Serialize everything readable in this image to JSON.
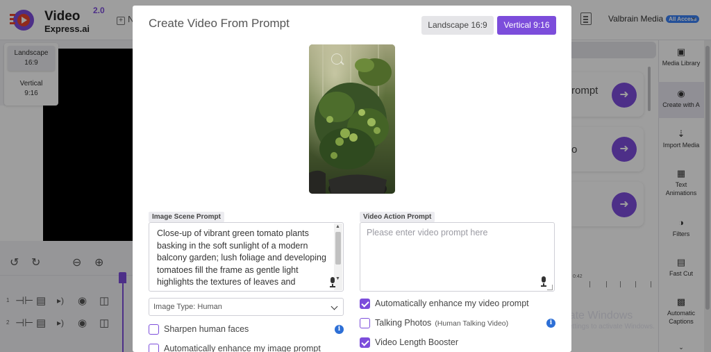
{
  "app": {
    "logo_name": "Video",
    "logo_sub": "Express.ai",
    "logo_version": "2.0",
    "top_new": "N",
    "user_name": "Valbrain Media",
    "access_badge": "All Access"
  },
  "ratio_panel": {
    "landscape": "Landscape\n16:9",
    "vertical": "Vertical\n9:16"
  },
  "right_panel": {
    "cards": [
      {
        "text": "rompt"
      },
      {
        "text": "o"
      },
      {
        "text": ""
      }
    ],
    "ruler_label": "0:42"
  },
  "sidebar": {
    "items": [
      {
        "label": "Media Library",
        "icon": "media-library-icon"
      },
      {
        "label": "Create with A",
        "icon": "robot-icon"
      },
      {
        "label": "Import Media",
        "icon": "import-icon"
      },
      {
        "label": "Text Animations",
        "icon": "film-icon"
      },
      {
        "label": "Filters",
        "icon": "filter-icon"
      },
      {
        "label": "Fast Cut",
        "icon": "fast-cut-icon"
      },
      {
        "label": "Automatic Captions",
        "icon": "captions-icon"
      }
    ]
  },
  "tracks": [
    {
      "num": "1"
    },
    {
      "num": "2"
    }
  ],
  "watermark": {
    "line1": "Activate Windows",
    "line2": "Go to Settings to activate Windows."
  },
  "modal": {
    "title": "Create Video From Prompt",
    "landscape_label": "Landscape 16:9",
    "vertical_label": "Vertical 9:16",
    "image_prompt_label": "Image Scene Prompt",
    "image_prompt_value": "Close-up of vibrant green tomato plants basking in the soft sunlight of a modern balcony garden; lush foliage and developing tomatoes fill the frame as gentle light highlights the textures of leaves and",
    "video_prompt_label": "Video Action Prompt",
    "video_prompt_placeholder": "Please enter video prompt here",
    "image_type": "Image Type: Human",
    "options_left": [
      {
        "label": "Sharpen human faces",
        "checked": false
      },
      {
        "label": "Automatically enhance my image prompt",
        "checked": false
      }
    ],
    "options_right": [
      {
        "label": "Automatically enhance my video prompt",
        "checked": true
      },
      {
        "label": "Talking Photos",
        "sub": "(Human Talking Video)",
        "checked": false
      },
      {
        "label": "Video Length Booster",
        "checked": true
      }
    ]
  },
  "colors": {
    "accent": "#7c4ddb",
    "info": "#2d6fd6",
    "badge": "#3b82f6"
  }
}
